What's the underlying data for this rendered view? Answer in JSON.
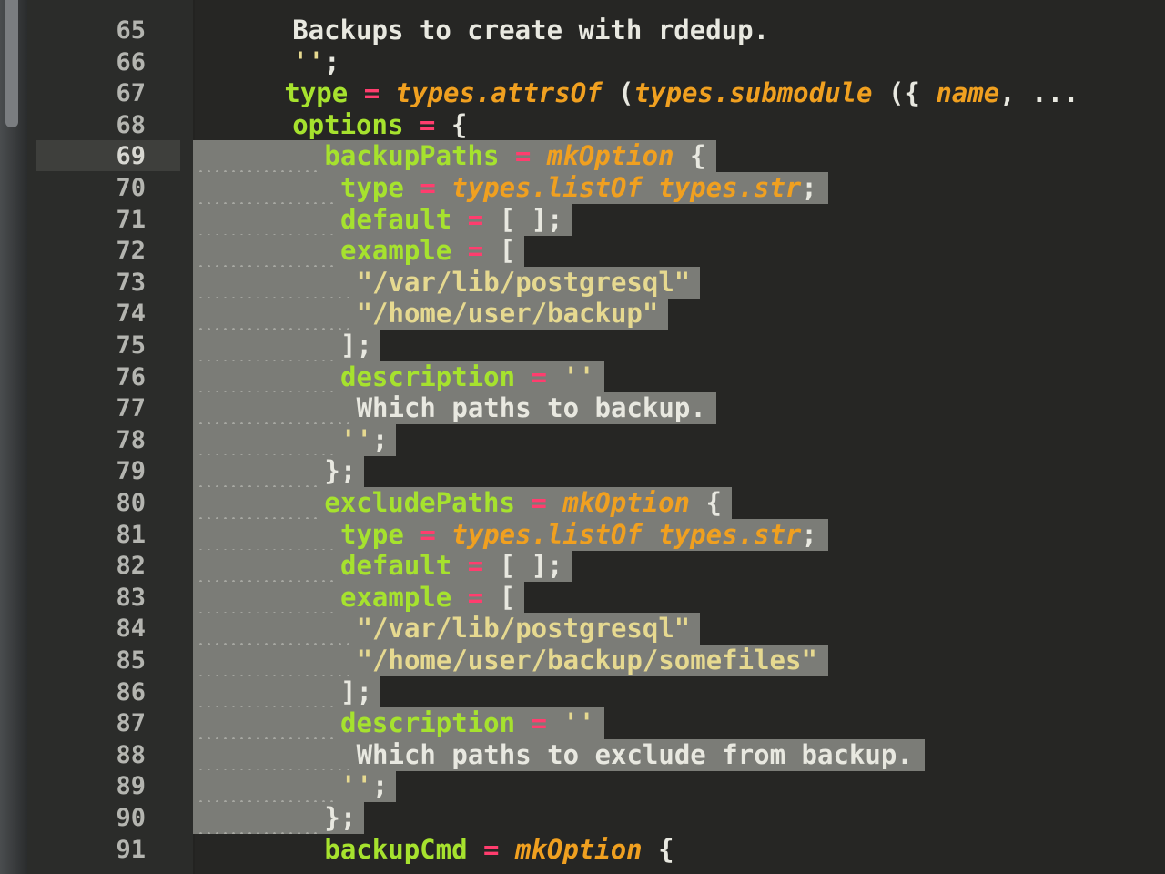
{
  "editor": {
    "language": "nix",
    "current_line": "69",
    "colors": {
      "background": "#262624",
      "gutter": "#2b2c2a",
      "selection": "#7b7c77",
      "keyword_green": "#a6e22e",
      "type_orange": "#f0a020",
      "operator_pink": "#ff3d6e",
      "string_yellow": "#e6d990"
    },
    "lines": [
      {
        "n": "65",
        "code": "Backups to create with rdedup."
      },
      {
        "n": "66",
        "code": "'';"
      },
      {
        "n": "67",
        "code": "type = types.attrsOf (types.submodule ({ name, ..."
      },
      {
        "n": "68",
        "code": "options = {"
      },
      {
        "n": "69",
        "code": "backupPaths = mkOption {"
      },
      {
        "n": "70",
        "code": "type = types.listOf types.str;"
      },
      {
        "n": "71",
        "code": "default = [ ];"
      },
      {
        "n": "72",
        "code": "example = ["
      },
      {
        "n": "73",
        "code": "\"/var/lib/postgresql\""
      },
      {
        "n": "74",
        "code": "\"/home/user/backup\""
      },
      {
        "n": "75",
        "code": "];"
      },
      {
        "n": "76",
        "code": "description = ''"
      },
      {
        "n": "77",
        "code": "Which paths to backup."
      },
      {
        "n": "78",
        "code": "'';"
      },
      {
        "n": "79",
        "code": "};"
      },
      {
        "n": "80",
        "code": "excludePaths = mkOption {"
      },
      {
        "n": "81",
        "code": "type = types.listOf types.str;"
      },
      {
        "n": "82",
        "code": "default = [ ];"
      },
      {
        "n": "83",
        "code": "example = ["
      },
      {
        "n": "84",
        "code": "\"/var/lib/postgresql\""
      },
      {
        "n": "85",
        "code": "\"/home/user/backup/somefiles\""
      },
      {
        "n": "86",
        "code": "];"
      },
      {
        "n": "87",
        "code": "description = ''"
      },
      {
        "n": "88",
        "code": "Which paths to exclude from backup."
      },
      {
        "n": "89",
        "code": "'';"
      },
      {
        "n": "90",
        "code": "};"
      },
      {
        "n": "91",
        "code": "backupCmd = mkOption {"
      }
    ]
  }
}
